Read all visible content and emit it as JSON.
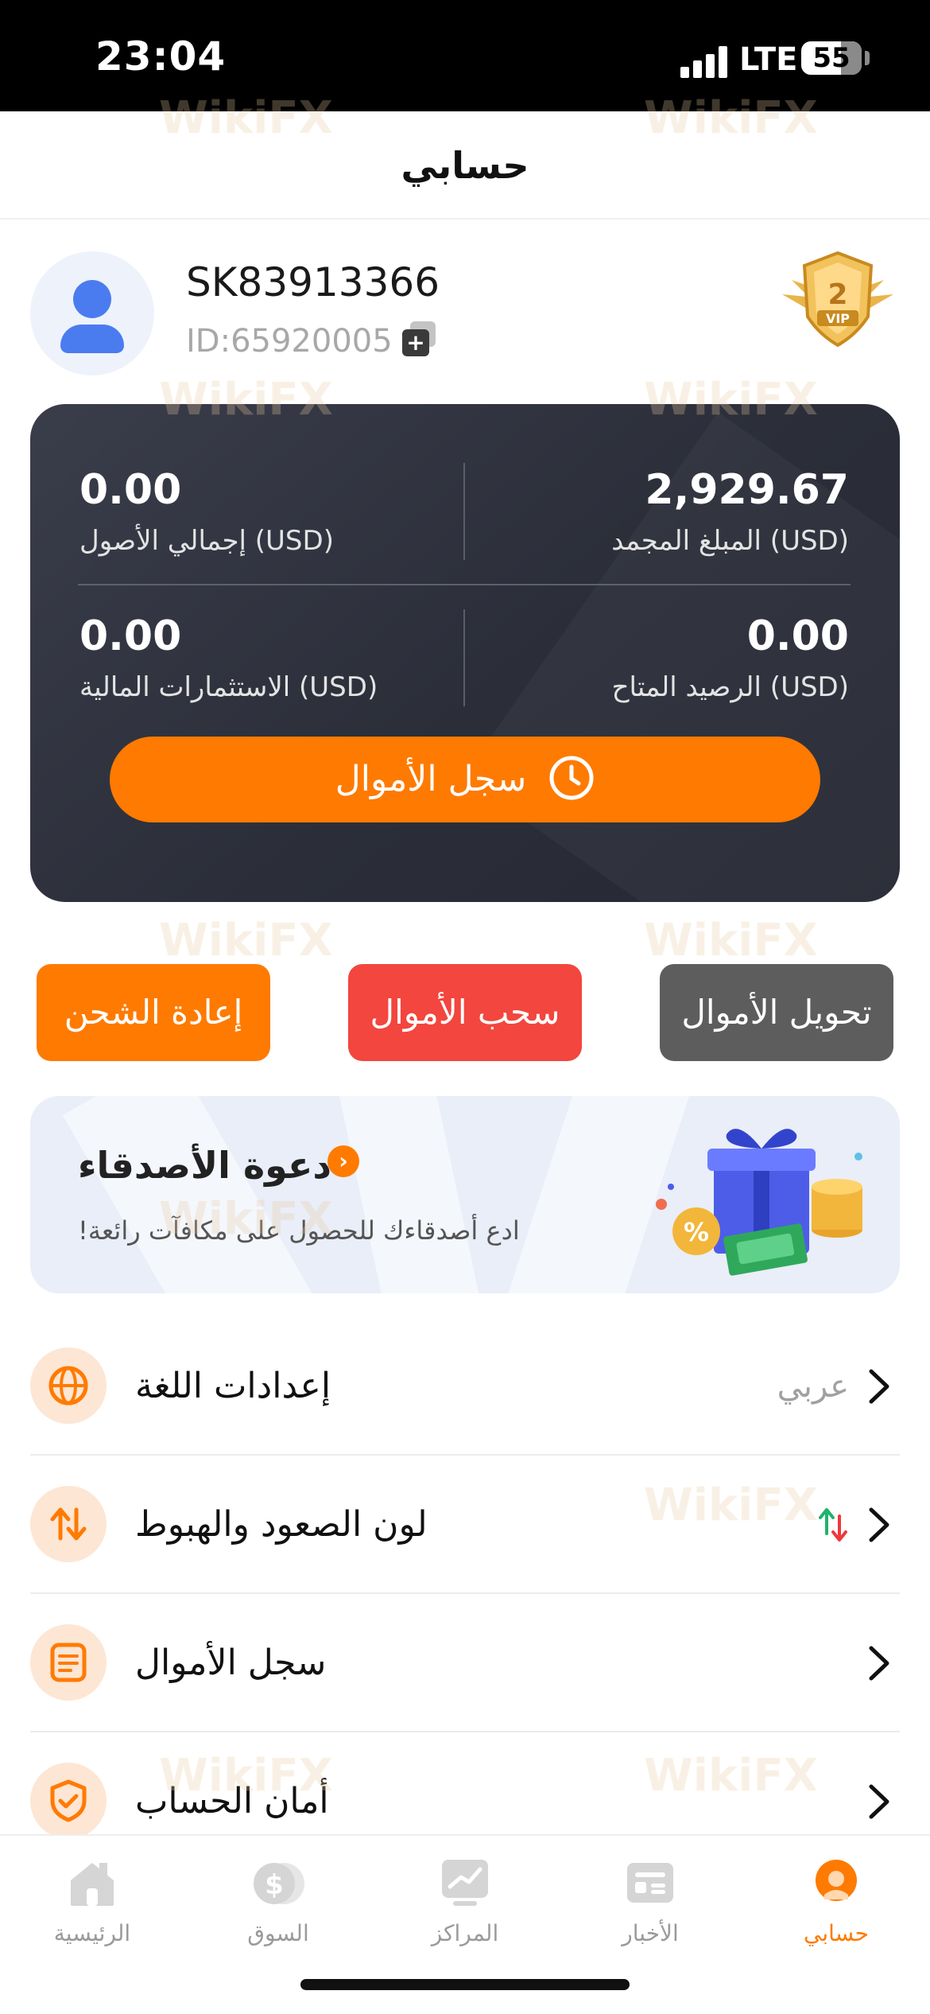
{
  "status_bar": {
    "time": "23:04",
    "network": "LTE",
    "battery": "55"
  },
  "header": {
    "title": "حسابي"
  },
  "profile": {
    "username": "SK83913366",
    "user_id": "ID:65920005",
    "vip_level": "2",
    "vip_label": "VIP"
  },
  "balances": {
    "total_assets": {
      "value": "0.00",
      "label": "إجمالي الأصول  (USD)"
    },
    "frozen_amount": {
      "value": "2,929.67",
      "label": "المبلغ المجمد  (USD)"
    },
    "investments": {
      "value": "0.00",
      "label": "الاستثمارات المالية  (USD)"
    },
    "available_balance": {
      "value": "0.00",
      "label": "الرصيد المتاح  (USD)"
    },
    "history_button": "سجل الأموال"
  },
  "actions": {
    "transfer": "تحويل الأموال",
    "withdraw": "سحب الأموال",
    "recharge": "إعادة الشحن"
  },
  "invite": {
    "title": "دعوة الأصدقاء",
    "subtitle": "!ادع أصدقاءك للحصول على مكافآت رائعة"
  },
  "menu": {
    "language": {
      "label": "إعدادات اللغة",
      "value": "عربي"
    },
    "color": {
      "label": "لون الصعود والهبوط"
    },
    "funds_log": {
      "label": "سجل الأموال"
    },
    "security": {
      "label": "أمان الحساب"
    }
  },
  "tabs": {
    "home": "الرئيسية",
    "market": "السوق",
    "positions": "المراكز",
    "news": "الأخبار",
    "account": "حسابي"
  },
  "watermark": "WikiFX",
  "colors": {
    "accent": "#ff7a00",
    "withdraw": "#f2463e",
    "transfer": "#5d5d5d",
    "card": "#2f323d"
  }
}
